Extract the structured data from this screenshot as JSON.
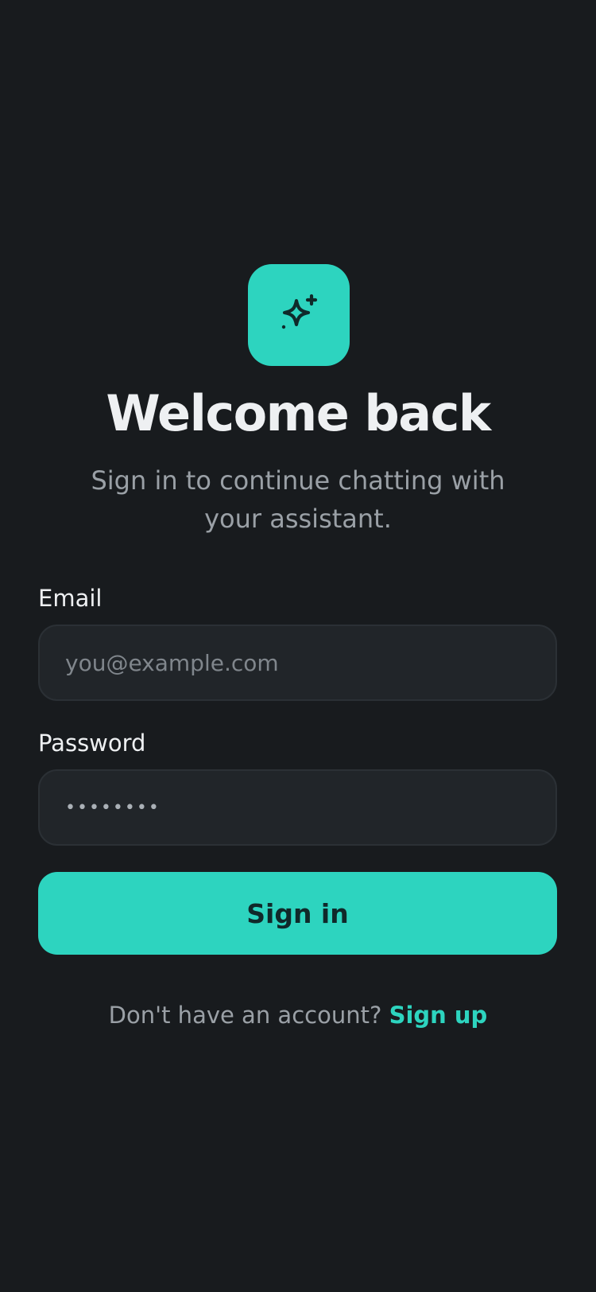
{
  "brand": {
    "icon": "sparkles-icon",
    "accent_color": "#2dd4bf",
    "background_color": "#181b1e"
  },
  "header": {
    "title": "Welcome back",
    "subtitle": "Sign in to continue chatting with your assistant."
  },
  "form": {
    "email": {
      "label": "Email",
      "placeholder": "you@example.com",
      "value": ""
    },
    "password": {
      "label": "Password",
      "value": "••••••••"
    },
    "submit_label": "Sign in"
  },
  "footer": {
    "prompt": "Don't have an account?",
    "link_label": "Sign up"
  }
}
